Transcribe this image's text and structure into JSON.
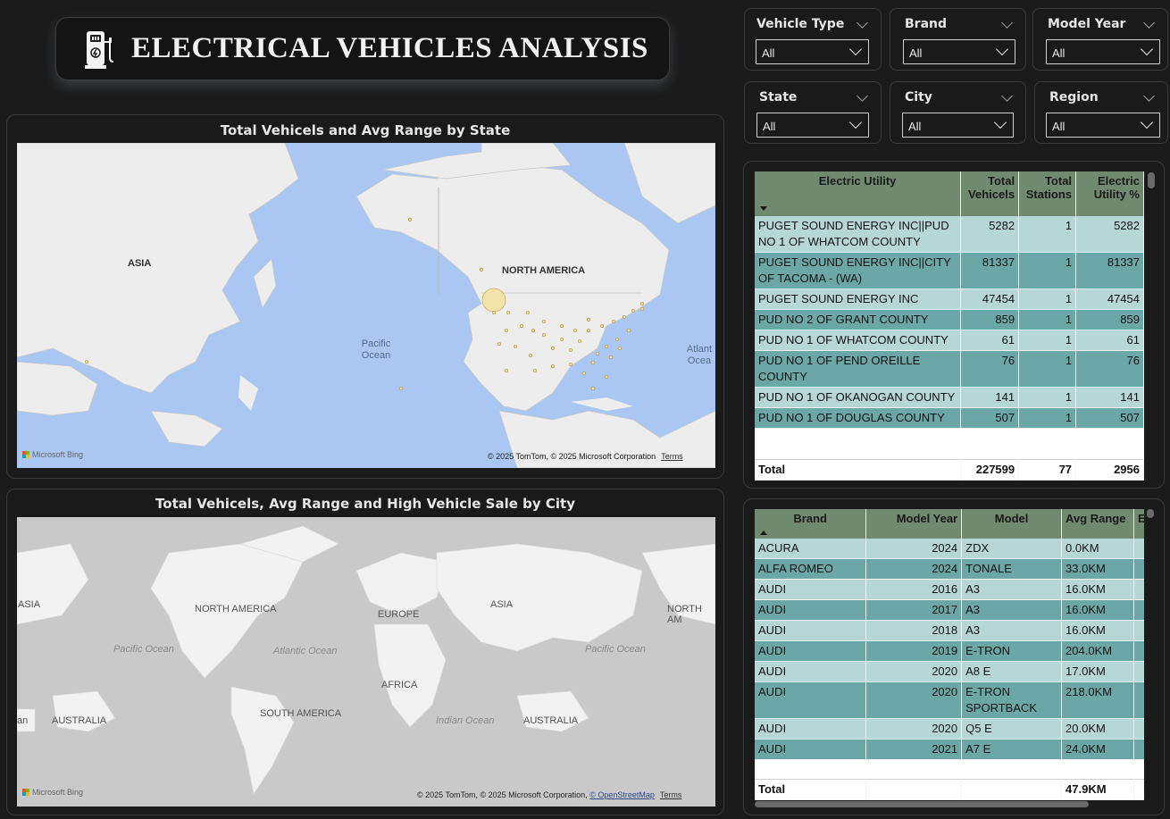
{
  "header": {
    "title": "ELECTRICAL VEHICLES ANALYSIS",
    "icon": "ev-charger-icon"
  },
  "slicers": [
    {
      "label": "Vehicle Type",
      "value": "All"
    },
    {
      "label": "Brand",
      "value": "All"
    },
    {
      "label": "Model Year",
      "value": "All"
    },
    {
      "label": "State",
      "value": "All"
    },
    {
      "label": "City",
      "value": "All"
    },
    {
      "label": "Region",
      "value": "All"
    }
  ],
  "map1": {
    "title": "Total Vehicels and Avg Range by State",
    "labels": {
      "asia": "ASIA",
      "north_america": "NORTH AMERICA",
      "pacific": "Pacific\nOcean",
      "atlantic": "Atlant\nOcea"
    },
    "credit": "© 2025 TomTom, © 2025 Microsoft Corporation",
    "terms": "Terms",
    "bing": "Microsoft Bing"
  },
  "map2": {
    "title": "Total Vehicels, Avg Range and High Vehicle Sale by City",
    "labels": {
      "asia_l": "ASIA",
      "north_america": "NORTH AMERICA",
      "europe": "EUROPE",
      "asia": "ASIA",
      "north_am_r": "NORTH AM",
      "pacific_l": "Pacific Ocean",
      "atlantic": "Atlantic Ocean",
      "africa": "AFRICA",
      "pacific_r": "Pacific Ocean",
      "an": "an",
      "australia_l": "AUSTRALIA",
      "south_america": "SOUTH AMERICA",
      "indian": "Indian Ocean",
      "australia_r": "AUSTRALIA"
    },
    "credit": "© 2025 TomTom, © 2025 Microsoft Corporation,",
    "osm": "© OpenStreetMap",
    "terms": "Terms",
    "bing": "Microsoft Bing"
  },
  "utility_table": {
    "columns": [
      "Electric Utility",
      "Total Vehicels",
      "Total Stations",
      "Electric Utility %"
    ],
    "rows": [
      [
        "PUGET SOUND ENERGY INC||PUD NO 1 OF WHATCOM COUNTY",
        "5282",
        "1",
        "5282"
      ],
      [
        "PUGET SOUND ENERGY INC||CITY OF TACOMA - (WA)",
        "81337",
        "1",
        "81337"
      ],
      [
        "PUGET SOUND ENERGY INC",
        "47454",
        "1",
        "47454"
      ],
      [
        "PUD NO 2 OF GRANT COUNTY",
        "859",
        "1",
        "859"
      ],
      [
        "PUD NO 1 OF WHATCOM COUNTY",
        "61",
        "1",
        "61"
      ],
      [
        "PUD NO 1 OF PEND OREILLE COUNTY",
        "76",
        "1",
        "76"
      ],
      [
        "PUD NO 1 OF OKANOGAN COUNTY",
        "141",
        "1",
        "141"
      ],
      [
        "PUD NO 1 OF DOUGLAS COUNTY",
        "507",
        "1",
        "507"
      ]
    ],
    "total": [
      "Total",
      "227599",
      "77",
      "2956"
    ]
  },
  "brand_table": {
    "columns": [
      "Brand",
      "Model Year",
      "Model",
      "Avg Range",
      "E"
    ],
    "rows": [
      [
        "ACURA",
        "2024",
        "ZDX",
        "0.0KM"
      ],
      [
        "ALFA ROMEO",
        "2024",
        "TONALE",
        "33.0KM"
      ],
      [
        "AUDI",
        "2016",
        "A3",
        "16.0KM"
      ],
      [
        "AUDI",
        "2017",
        "A3",
        "16.0KM"
      ],
      [
        "AUDI",
        "2018",
        "A3",
        "16.0KM"
      ],
      [
        "AUDI",
        "2019",
        "E-TRON",
        "204.0KM"
      ],
      [
        "AUDI",
        "2020",
        "A8 E",
        "17.0KM"
      ],
      [
        "AUDI",
        "2020",
        "E-TRON SPORTBACK",
        "218.0KM"
      ],
      [
        "AUDI",
        "2020",
        "Q5 E",
        "20.0KM"
      ],
      [
        "AUDI",
        "2021",
        "A7 E",
        "24.0KM"
      ]
    ],
    "total": [
      "Total",
      "",
      "",
      "47.9KM"
    ]
  }
}
